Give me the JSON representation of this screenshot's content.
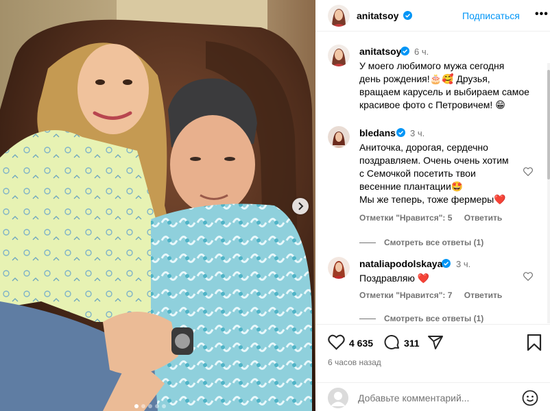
{
  "post": {
    "author": "anitatsoy",
    "follow_label": "Подписаться",
    "more_label": "•••",
    "caption": {
      "username": "anitatsoy",
      "time": "6 ч.",
      "text_lines": [
        "У моего любимого  мужа  сегодня",
        "день рождения!🎂🥰 Друзья,",
        "вращаем карусель и выбираем самое",
        "красивое фото с Петровичем! 😁"
      ]
    },
    "comments": [
      {
        "username": "bledans",
        "time": "3 ч.",
        "text_lines": [
          "Аниточка, дорогая, сердечно",
          "поздравляем. Очень очень хотим",
          "с Семочкой посетить твои",
          "весенние плантации🤩",
          "Мы же теперь, тоже фермеры❤️"
        ],
        "likes_label": "Отметки \"Нравится\": 5",
        "reply_label": "Ответить",
        "view_replies": "Смотреть все ответы (1)"
      },
      {
        "username": "nataliapodolskaya",
        "time": "3 ч.",
        "text_lines": [
          "Поздравляю ❤️"
        ],
        "likes_label": "Отметки \"Нравится\": 7",
        "reply_label": "Ответить",
        "view_replies": "Смотреть все ответы (1)"
      }
    ],
    "likes_count": "4 635",
    "comments_count": "311",
    "posted_ago": "6 часов назад",
    "add_comment_placeholder": "Добавьте комментарий...",
    "carousel": {
      "slides": 5,
      "active": 0
    }
  },
  "colors": {
    "link_blue": "#0095f6",
    "verified_blue": "#0095f6",
    "secondary_text": "#737373",
    "heart_red": "#ed4956"
  },
  "icons": [
    "verified-badge-icon",
    "more-options-icon",
    "heart-icon",
    "comment-icon",
    "share-icon",
    "bookmark-icon",
    "emoji-icon",
    "chevron-right-icon"
  ]
}
